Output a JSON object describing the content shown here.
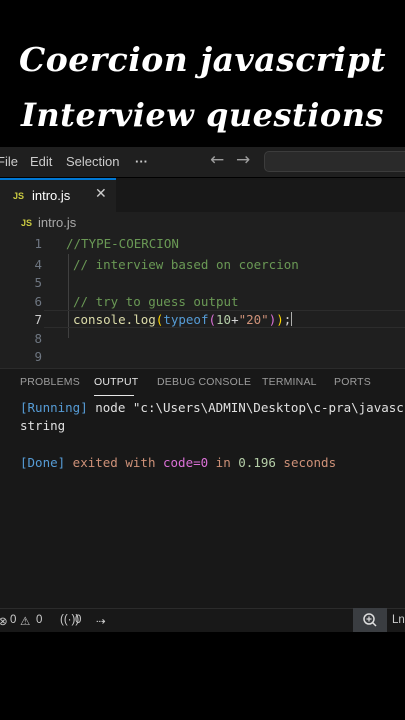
{
  "banner": {
    "line1": "Coercion javascript",
    "line2": "Interview questions"
  },
  "menubar": {
    "items": [
      "File",
      "Edit",
      "Selection",
      "···"
    ],
    "back_arrow": "←",
    "forward_arrow": "→"
  },
  "tab": {
    "badge": "JS",
    "label": "intro.js",
    "close": "✕"
  },
  "breadcrumb": {
    "badge": "JS",
    "label": "intro.js"
  },
  "editor": {
    "line_numbers": [
      "1",
      "4",
      "5",
      "6",
      "7",
      "8",
      "9"
    ],
    "active_line": "7",
    "lines": {
      "l1": "//TYPE-COERCION",
      "l4": "// interview based on coercion",
      "l6": "// try to guess output",
      "l7": {
        "fn": "console.log",
        "open1": "(",
        "kw": "typeof",
        "open2": "(",
        "num": "10",
        "plus": "+",
        "str": "\"20\"",
        "close2": ")",
        "close1": ")",
        "semi": ";"
      }
    }
  },
  "panel": {
    "tabs": [
      "PROBLEMS",
      "OUTPUT",
      "DEBUG CONSOLE",
      "TERMINAL",
      "PORTS"
    ],
    "active_tab": "OUTPUT",
    "running_tag": "[Running]",
    "running_cmd": " node \"c:\\Users\\ADMIN\\Desktop\\c-pra\\javascr",
    "result": "string",
    "done_tag": "[Done]",
    "done_text_1": " exited with ",
    "done_code": "code=0",
    "done_text_2": " in ",
    "done_time": "0.196",
    "done_text_3": " seconds"
  },
  "statusbar": {
    "errors": "0",
    "warnings": "0",
    "ports": "0",
    "right_text": "Ln"
  },
  "colors": {
    "accent": "#0078d4",
    "js_badge": "#cbcb41",
    "comment": "#6a9955",
    "keyword": "#569cd6",
    "string": "#ce9178",
    "number": "#b5cea8",
    "function": "#dcdcaa"
  }
}
